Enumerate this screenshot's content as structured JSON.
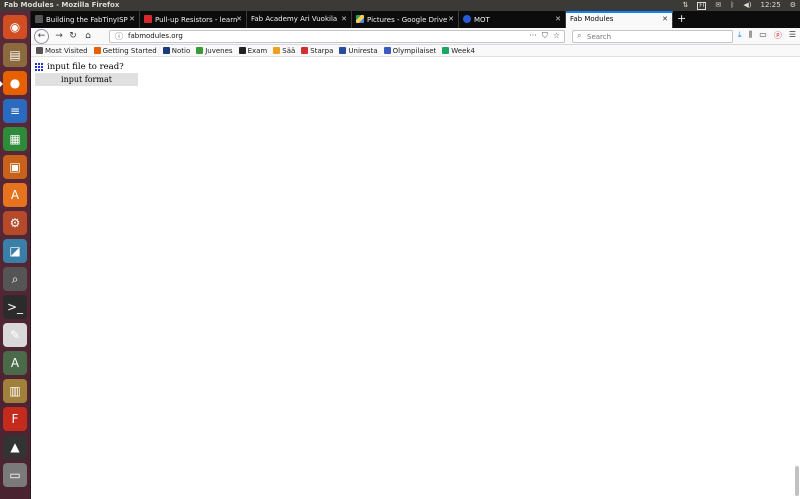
{
  "os": {
    "window_title": "Fab Modules - Mozilla Firefox",
    "clock": "12:25",
    "keyboard_layout": "FI"
  },
  "launcher": {
    "items": [
      {
        "name": "dash",
        "glyph": "◉",
        "color": "#d04e22"
      },
      {
        "name": "files",
        "glyph": "▤",
        "color": "#8b6a3e"
      },
      {
        "name": "firefox",
        "glyph": "●",
        "color": "#e66000",
        "active": true
      },
      {
        "name": "writer",
        "glyph": "≡",
        "color": "#2a6bbf"
      },
      {
        "name": "calc",
        "glyph": "▦",
        "color": "#2e8b3a"
      },
      {
        "name": "impress",
        "glyph": "▣",
        "color": "#c8611a"
      },
      {
        "name": "software",
        "glyph": "A",
        "color": "#e8731e"
      },
      {
        "name": "settings",
        "glyph": "⚙",
        "color": "#b44a2a"
      },
      {
        "name": "monitor",
        "glyph": "◪",
        "color": "#3a7fa8"
      },
      {
        "name": "magnifier",
        "glyph": "⌕",
        "color": "#555555"
      },
      {
        "name": "terminal",
        "glyph": ">_",
        "color": "#2b2b2b"
      },
      {
        "name": "editor",
        "glyph": "✎",
        "color": "#d9d9d9"
      },
      {
        "name": "updater",
        "glyph": "A",
        "color": "#4a6a4a"
      },
      {
        "name": "archive",
        "glyph": "▥",
        "color": "#a0803a"
      },
      {
        "name": "filezilla",
        "glyph": "F",
        "color": "#c42b1c"
      },
      {
        "name": "inkscape",
        "glyph": "▲",
        "color": "#333333"
      },
      {
        "name": "trash",
        "glyph": "▭",
        "color": "#7a7a7a"
      }
    ]
  },
  "tabs": [
    {
      "label": "Building the FabTinyISP",
      "icon_color": "#555555",
      "active": false
    },
    {
      "label": "Pull-up Resistors - learn",
      "icon_color": "#d9272e",
      "active": false
    },
    {
      "label": "Fab Academy Ari Vuokila",
      "icon_color": "#555555",
      "active": false
    },
    {
      "label": "Pictures - Google Drive",
      "icon_color": "#1fa463",
      "active": false
    },
    {
      "label": "MOT",
      "icon_color": "#2a5bd7",
      "active": false
    },
    {
      "label": "Fab Modules",
      "icon_color": "",
      "active": true
    }
  ],
  "navbar": {
    "url": "fabmodules.org",
    "search_placeholder": "Search"
  },
  "bookmarks": [
    {
      "label": "Most Visited",
      "icon": "gear-icon",
      "color": "#555555"
    },
    {
      "label": "Getting Started",
      "icon": "firefox-icon",
      "color": "#e66000"
    },
    {
      "label": "Notio",
      "icon": "notio-icon",
      "color": "#1a3a7a"
    },
    {
      "label": "Juvenes",
      "icon": "juvenes-icon",
      "color": "#3a9a3a"
    },
    {
      "label": "Exam",
      "icon": "exam-icon",
      "color": "#222222"
    },
    {
      "label": "Sää",
      "icon": "weather-icon",
      "color": "#f0a020"
    },
    {
      "label": "Starpa",
      "icon": "starpa-icon",
      "color": "#d03030"
    },
    {
      "label": "Uniresta",
      "icon": "uniresta-icon",
      "color": "#2a4aa0"
    },
    {
      "label": "Olympilaiset",
      "icon": "olympics-icon",
      "color": "#3a5ac0"
    },
    {
      "label": "Week4",
      "icon": "drive-icon",
      "color": "#1fa463"
    }
  ],
  "page": {
    "prompt": "input file to read?",
    "format_button": "input format",
    "logo_color": "#1f2fd6"
  }
}
